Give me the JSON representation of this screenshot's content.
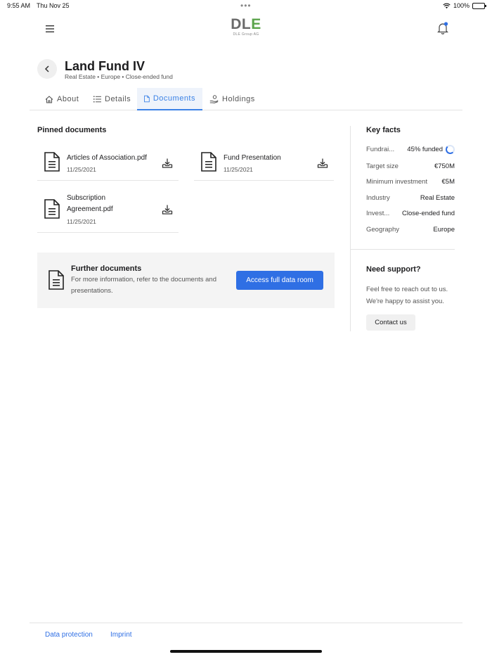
{
  "status_bar": {
    "time": "9:55 AM",
    "date": "Thu Nov 25",
    "battery": "100%"
  },
  "logo": {
    "main_a": "DL",
    "main_b": "E",
    "sub": "DLE Group AG"
  },
  "header": {
    "title": "Land Fund IV",
    "subtitle": "Real Estate • Europe • Close-ended fund"
  },
  "tabs": [
    {
      "label": "About"
    },
    {
      "label": "Details"
    },
    {
      "label": "Documents",
      "active": true
    },
    {
      "label": "Holdings"
    }
  ],
  "pinned": {
    "title": "Pinned documents",
    "documents": [
      {
        "name": "Articles of Association.pdf",
        "date": "11/25/2021"
      },
      {
        "name": "Fund Presentation",
        "date": "11/25/2021"
      },
      {
        "name": "Subscription Agreement.pdf",
        "date": "11/25/2021"
      }
    ]
  },
  "further": {
    "title": "Further documents",
    "text": "For more information, refer to the documents and presentations.",
    "button": "Access full data room"
  },
  "key_facts": {
    "title": "Key facts",
    "rows": [
      {
        "label": "Fundrai...",
        "value": "45% funded",
        "funded_fraction": 0.45
      },
      {
        "label": "Target size",
        "value": "€750M"
      },
      {
        "label": "Minimum investment",
        "value": "€5M"
      },
      {
        "label": "Industry",
        "value": "Real Estate"
      },
      {
        "label": "Invest...",
        "value": "Close-ended fund"
      },
      {
        "label": "Geography",
        "value": "Europe"
      }
    ]
  },
  "support": {
    "title": "Need support?",
    "text": "Feel free to reach out to us. We're happy to assist you.",
    "button": "Contact us"
  },
  "footer": {
    "links": [
      {
        "label": "Data protection"
      },
      {
        "label": "Imprint"
      }
    ]
  },
  "colors": {
    "accent": "#2f6fe4",
    "logo_green": "#5aa34a",
    "logo_gray": "#6a6a6a"
  }
}
